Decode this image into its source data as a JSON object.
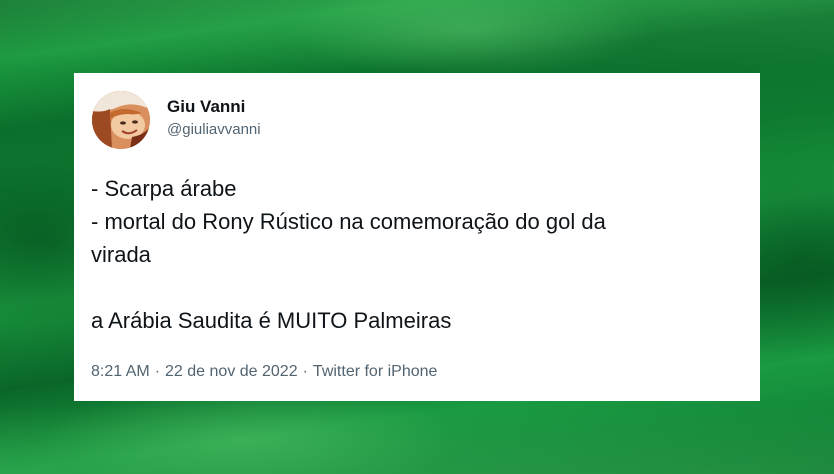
{
  "tweet": {
    "author": {
      "name": "Giu Vanni",
      "handle": "@giuliavvanni"
    },
    "lines": [
      "- Scarpa árabe",
      "- mortal do Rony Rústico na comemoração do gol da",
      "virada",
      "a Arábia Saudita é MUITO Palmeiras"
    ],
    "meta": {
      "time": "8:21 AM",
      "date": "22 de nov de 2022",
      "source": "Twitter for iPhone",
      "separator": "·"
    }
  },
  "colors": {
    "background": "#128a38",
    "card": "#ffffff",
    "text_primary": "#0f1419",
    "text_secondary": "#536471"
  },
  "icons": {
    "avatar": "profile-photo"
  }
}
